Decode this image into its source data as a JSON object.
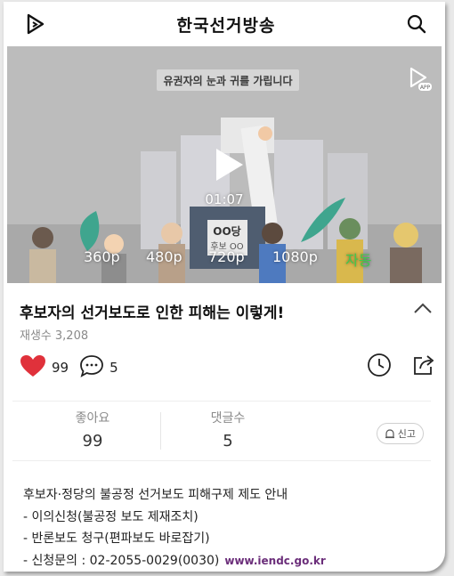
{
  "header": {
    "title": "한국선거방송",
    "logo_icon": "play-outline-icon",
    "search_icon": "search-icon"
  },
  "video": {
    "banner_text": "유권자의 눈과 귀를 가립니다",
    "sign_text": "OO당",
    "sign_number": "후보 OO",
    "duration": "01:07",
    "app_badge_text": "APP",
    "qualities": [
      "360p",
      "480p",
      "720p",
      "1080p",
      "자동"
    ],
    "selected_quality": "자동"
  },
  "content": {
    "title": "후보자의 선거보도로 인한 피해는 이렇게!",
    "views_label": "재생수",
    "views_value": "3,208",
    "likes": "99",
    "comments": "5"
  },
  "stats": {
    "likes_label": "좋아요",
    "likes_value": "99",
    "comments_label": "댓글수",
    "comments_value": "5",
    "report_label": "신고"
  },
  "description": {
    "lines": [
      "후보자·정당의 불공정 선거보도 피해구제 제도 안내",
      "- 이의신청(불공정 보도 제재조치)",
      "- 반론보도 청구(편파보도 바로잡기)",
      "- 신청문의 : 02-2055-0029(0030)"
    ],
    "url": "www.iendc.go.kr"
  },
  "colors": {
    "accent_green": "#3fc94f",
    "heart_red": "#e0313b",
    "url_purple": "#6b2e7a"
  }
}
